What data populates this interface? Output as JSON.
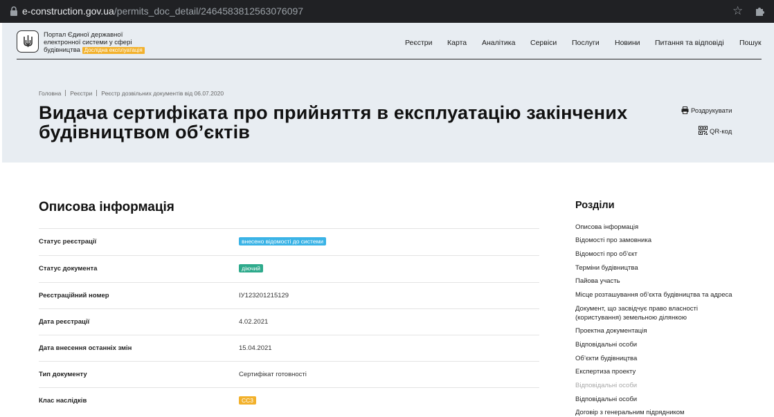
{
  "browser": {
    "host": "e-construction.gov.ua",
    "path": "/permits_doc_detail/2464583812563076097",
    "icons": [
      "lock-icon",
      "star-icon",
      "extension-icon"
    ]
  },
  "header": {
    "brand_line1": "Портал Єдиної державної",
    "brand_line2": "електронної системи у сфері",
    "brand_line3": "будівництва",
    "brand_badge": "Дослідна експлуатація",
    "nav": [
      "Реєстри",
      "Карта",
      "Аналітика",
      "Сервіси",
      "Послуги",
      "Новини",
      "Питання та відповіді",
      "Пошук"
    ]
  },
  "breadcrumb": [
    "Головна",
    "Реєстри",
    "Реєстр дозвільних документів від 06.07.2020"
  ],
  "page": {
    "title": "Видача сертифіката про прийняття в експлуатацію закінчених будівництвом об’єктів",
    "print_label": "Роздрукувати",
    "qr_label": "QR-код"
  },
  "main": {
    "section_title": "Описова інформація",
    "rows": [
      {
        "key": "Статус реєстрації",
        "value": "внесено відомості до системи",
        "tag_color": "#3ab3e6"
      },
      {
        "key": "Статус документа",
        "value": "діючий",
        "tag_color": "#2eaa8c"
      },
      {
        "key": "Реєстраційний номер",
        "value": "ІУ123201215129"
      },
      {
        "key": "Дата реєстрації",
        "value": "4.02.2021"
      },
      {
        "key": "Дата внесення останніх змін",
        "value": "15.04.2021"
      },
      {
        "key": "Тип документу",
        "value": "Сертифікат готовності"
      },
      {
        "key": "Клас наслідків",
        "value": "СС3",
        "tag_color": "#f2b12c"
      }
    ]
  },
  "sidebar": {
    "title": "Розділи",
    "items": [
      "Описова інформація",
      "Відомості про замовника",
      "Відомості про об’єкт",
      "Терміни будівництва",
      "Пайова участь",
      "Місце розташування об’єкта будівництва та адреса",
      "Документ, що засвідчує право власності (користування) земельною ділянкою",
      "Проектна документація",
      "Відповідальні особи",
      "Об’єкти будівництва",
      "Експертиза проекту",
      "Відповідальні особи",
      "Відповідальні особи",
      "Договір з генеральним підрядником"
    ]
  }
}
